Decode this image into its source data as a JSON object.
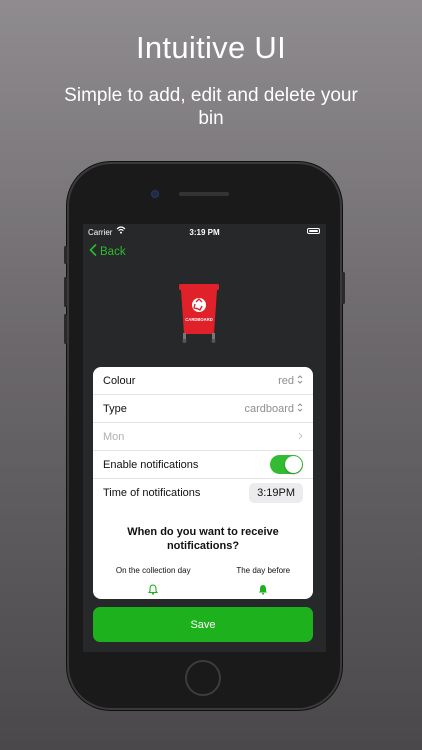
{
  "promo": {
    "title": "Intuitive UI",
    "subtitle": "Simple to add, edit and delete your bin"
  },
  "status_bar": {
    "carrier": "Carrier",
    "time": "3:19 PM"
  },
  "nav": {
    "back_label": "Back"
  },
  "bin": {
    "label": "CARDBOARD",
    "color": "#e0212a"
  },
  "form": {
    "colour_label": "Colour",
    "colour_value": "red",
    "type_label": "Type",
    "type_value": "cardboard",
    "day_value": "Mon",
    "notifications_label": "Enable notifications",
    "notifications_enabled": true,
    "time_label": "Time of notifications",
    "time_value": "3:19PM"
  },
  "notify": {
    "question": "When do you want to receive notifications?",
    "option_same_day": "On the collection day",
    "option_day_before": "The day before"
  },
  "save_label": "Save",
  "colors": {
    "accent": "#1db21d",
    "background": "#26282a"
  }
}
